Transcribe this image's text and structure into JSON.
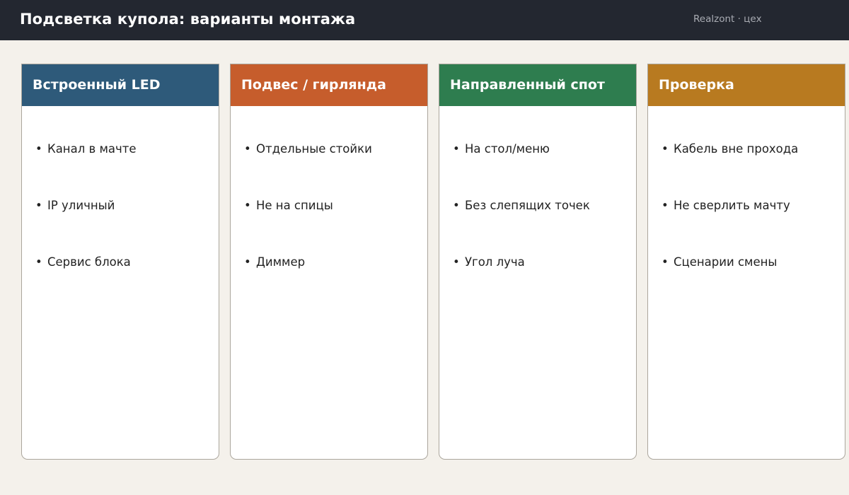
{
  "header": {
    "title": "Подсветка купола: варианты монтажа",
    "brand": "Realzont · цех"
  },
  "cards": [
    {
      "title": "Встроенный LED",
      "color": "#2e5a7a",
      "items": [
        "Канал в мачте",
        "IP уличный",
        "Сервис блока"
      ]
    },
    {
      "title": "Подвес / гирлянда",
      "color": "#c65d2c",
      "items": [
        "Отдельные стойки",
        "Не на спицы",
        "Диммер"
      ]
    },
    {
      "title": "Направленный спот",
      "color": "#2e7d4f",
      "items": [
        "На стол/меню",
        "Без слепящих точек",
        "Угол луча"
      ]
    },
    {
      "title": "Проверка",
      "color": "#b87a20",
      "items": [
        "Кабель вне прохода",
        "Не сверлить мачту",
        "Сценарии смены"
      ]
    }
  ]
}
